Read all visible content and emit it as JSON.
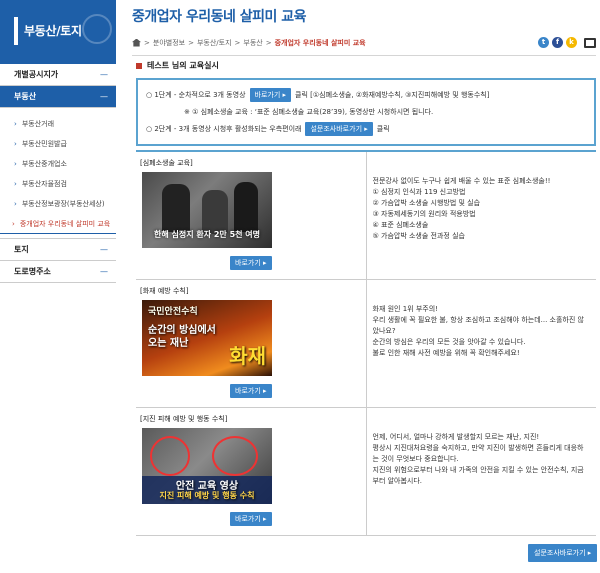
{
  "sidebar": {
    "title": "부동산/토지",
    "menu": [
      {
        "label": "개별공시지가",
        "mark": "—"
      },
      {
        "label": "부동산",
        "mark": "—"
      }
    ],
    "subitems": [
      "부동산거래",
      "부동산민원발급",
      "부동산중개업소",
      "부동산자율점검",
      "부동산정보광장(부동산세상)",
      "중개업자 우리동네 살피미 교육"
    ],
    "menu_after": [
      {
        "label": "토지",
        "mark": "—"
      },
      {
        "label": "도로명주소",
        "mark": "—"
      }
    ]
  },
  "header": {
    "page_title": "중개업자 우리동네 살피미 교육",
    "breadcrumb": [
      "분야별정보",
      "부동산/토지",
      "부동산",
      "중개업자 우리동네 살피미 교육"
    ],
    "crumb_sep": ">",
    "share": {
      "twitter": "t",
      "facebook": "f",
      "kakao": "k"
    }
  },
  "section_label": "테스트 님의 교육실시",
  "steps": {
    "step1_prefix": "○ 1단계 - 순차적으로 3개 동영상",
    "step1_button": "바로가기",
    "step1_suffix": "클릭 [①심폐소생술, ②화재예방수칙, ③지진피해예방 및 행동수칙]",
    "step1_note": "※ ① 심폐소생술 교육 : ‘표준 심폐소생술 교육(28’39), 동영상만 시청하시면 됩니다.",
    "step2_prefix": "○ 2단계 - 3개 동영상 시청후 활성화되는 우측편이래",
    "step2_button": "설문조사바로가기",
    "step2_suffix": "클릭"
  },
  "courses": [
    {
      "label": "[심폐소생술 교육]",
      "thumb_caption": "한해 심정지 환자 2만 5천 여명",
      "button": "바로가기",
      "desc": [
        "전문강사 없이도 누구나 쉽게 배울 수 있는 표준 심폐소생술!!",
        "① 심정지 인식과 119 신고방법",
        "② 가슴압박 소생술 시행방법 및 실습",
        "③ 자동제세동기의 원리와 적용방법",
        "④ 표준 심폐소생술",
        "⑤ 가슴압박 소생술 전과정 실습"
      ]
    },
    {
      "label": "[화재 예방 수칙]",
      "thumb_top": "국민안전수칙",
      "thumb_mid": "순간의 방심에서 오는 재난",
      "thumb_big": "화재",
      "button": "바로가기",
      "desc": [
        "화재 원인 1위 부주의!",
        "우리 생활에 꼭 필요한 불, 항상 조심하고 조심해야 하는데... 소홀하진 않",
        "았나요?",
        "순간의 방심은 우리의 모든 것을 앗아갈 수 있습니다.",
        "불로 인한 재해 사전 예방을 위해 꼭 확인해주세요!"
      ]
    },
    {
      "label": "[지진 피해 예방 및 행동 수칙]",
      "thumb_top": "안전 교육 영상",
      "thumb_big": "지진 피해 예방 및 행동 수칙",
      "button": "바로가기",
      "desc": [
        "언제, 어디서, 얼마나 강하게 발생할지 모르는 재난, 지진!",
        "평상시 지진대처요령을 숙지하고, 만약 지진이 발생하면 흔들리게 대응하",
        "는 것이 무엇보다 중요합니다.",
        "지진의 위험으로부터 나와 내 가족의 안전을 지킬 수 있는 안전수칙, 지금",
        "부터 알아봅시다."
      ]
    }
  ],
  "survey_button": "설문조사바로가기",
  "colors": {
    "brand": "#1e5fa8",
    "accent": "#c0392b",
    "button": "#3a85c9",
    "border": "#5ba3d0"
  }
}
